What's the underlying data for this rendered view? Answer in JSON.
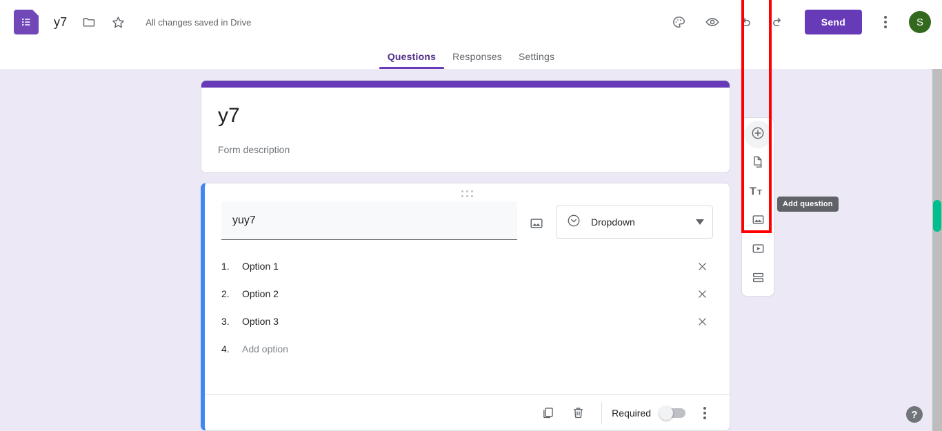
{
  "app": {
    "logo_icon": "google-forms-icon",
    "doc_title": "y7",
    "save_status": "All changes saved in Drive"
  },
  "topbar": {
    "folder_icon": "folder-icon",
    "star_icon": "star-icon",
    "theme_icon": "palette-icon",
    "preview_icon": "eye-icon",
    "undo_icon": "undo-icon",
    "redo_icon": "redo-icon",
    "send_label": "Send",
    "more_icon": "kebab-more-icon",
    "avatar_initial": "S",
    "avatar_color": "#33691e",
    "accent_color": "#673ab7"
  },
  "tabs": [
    {
      "label": "Questions",
      "active": true
    },
    {
      "label": "Responses",
      "active": false
    },
    {
      "label": "Settings",
      "active": false
    }
  ],
  "form_header": {
    "title": "y7",
    "description": "Form description",
    "stripe_color": "#673ab7"
  },
  "question": {
    "drag_icon": "drag-handle-icon",
    "title_value": "yuy7",
    "title_placeholder": "Question",
    "image_icon": "add-image-icon",
    "type": {
      "icon": "dropdown-type-icon",
      "label": "Dropdown",
      "chevron_icon": "chevron-down-icon"
    },
    "options": [
      {
        "num": "1.",
        "label": "Option 1",
        "placeholder": false,
        "remove_icon": "close-icon"
      },
      {
        "num": "2.",
        "label": "Option 2",
        "placeholder": false,
        "remove_icon": "close-icon"
      },
      {
        "num": "3.",
        "label": "Option 3",
        "placeholder": false,
        "remove_icon": "close-icon"
      },
      {
        "num": "4.",
        "label": "Add option",
        "placeholder": true,
        "remove_icon": ""
      }
    ],
    "footer": {
      "duplicate_icon": "duplicate-icon",
      "delete_icon": "trash-icon",
      "required_label": "Required",
      "required_on": false,
      "more_icon": "kebab-more-icon"
    },
    "accent_color": "#4285f4"
  },
  "side_toolbar": {
    "items": [
      {
        "icon": "add-question-icon",
        "name": "add-question"
      },
      {
        "icon": "import-questions-icon",
        "name": "import-questions"
      },
      {
        "icon": "add-title-icon",
        "name": "add-title-and-description"
      },
      {
        "icon": "add-image-icon",
        "name": "add-image"
      },
      {
        "icon": "add-video-icon",
        "name": "add-video"
      },
      {
        "icon": "add-section-icon",
        "name": "add-section"
      }
    ],
    "tooltip": "Add question"
  },
  "help": {
    "icon": "help-icon",
    "label": "?"
  },
  "scrollbar": {
    "thumb_color": "#00bf8f",
    "track_color": "#bdbdbd"
  },
  "highlight": {
    "color": "#fe0000"
  }
}
